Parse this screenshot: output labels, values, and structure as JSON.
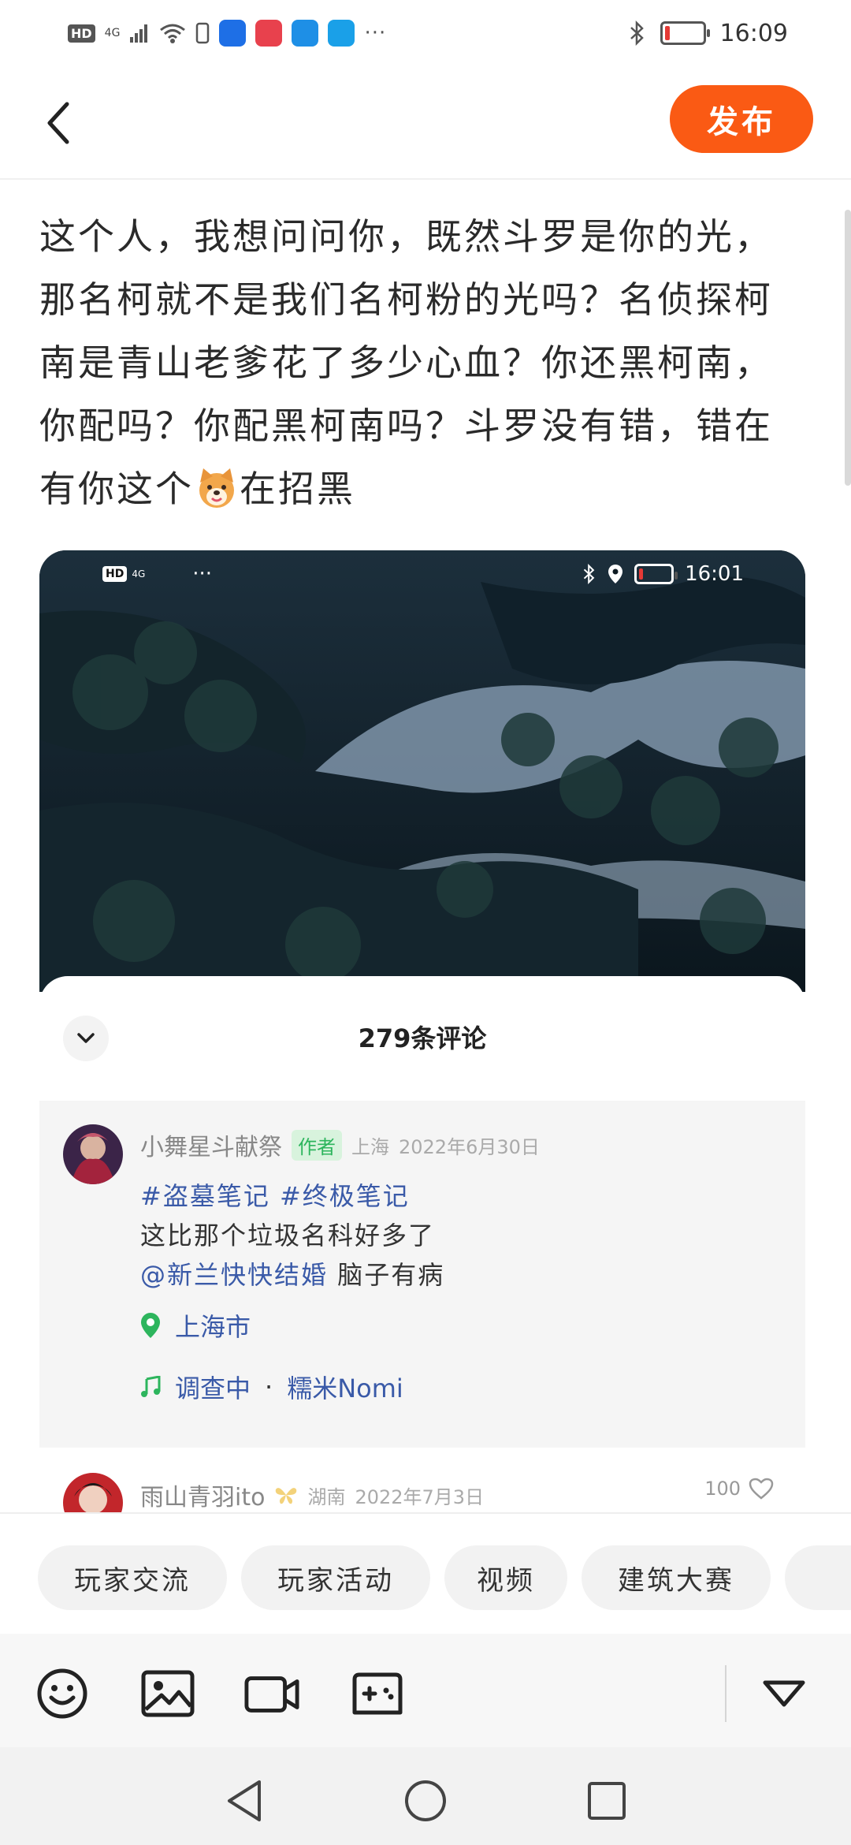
{
  "status_bar": {
    "network": "4G",
    "hd": "HD",
    "time": "16:09",
    "more": "···"
  },
  "header": {
    "back_icon": "chevron-left-icon",
    "publish_label": "发布"
  },
  "post": {
    "text_before": "这个人，我想问问你，既然斗罗是你的光，那名柯就不是我们名柯粉的光吗？名侦探柯南是青山老爹花了多少心血？你还黑柯南，你配吗？你配黑柯南吗？斗罗没有错，错在有你这个",
    "emoji": "dog-face-emoji",
    "text_after": "在招黑"
  },
  "video": {
    "status_time": "16:01",
    "hd": "HD",
    "network": "4G",
    "more": "···"
  },
  "comments": {
    "title": "279条评论",
    "pinned": {
      "username": "小舞星斗献祭",
      "badge": "作者",
      "location": "上海",
      "date": "2022年6月30日",
      "tags": "#盗墓笔记 #终极笔记",
      "line2": "这比那个垃圾名科好多了",
      "mention": "@新兰快快结婚",
      "mention_rest": " 脑子有病",
      "place": "上海市",
      "music_title": "调查中",
      "music_sep": "·",
      "music_artist": "糯米Nomi"
    },
    "second": {
      "username": "雨山青羽ito",
      "location": "湖南",
      "date": "2022年7月3日",
      "likes": "100"
    }
  },
  "chips": [
    "玩家交流",
    "玩家活动",
    "视频",
    "建筑大赛"
  ],
  "toolbar": {
    "icons": [
      "smiley-icon",
      "image-icon",
      "video-camera-icon",
      "gamepad-icon",
      "collapse-triangle-icon"
    ]
  },
  "colors": {
    "accent": "#fa5a14",
    "author_badge_bg": "#d8f3dd",
    "author_badge_text": "#2db55d",
    "link": "#3a5aa8",
    "battery_low": "#e53935"
  }
}
